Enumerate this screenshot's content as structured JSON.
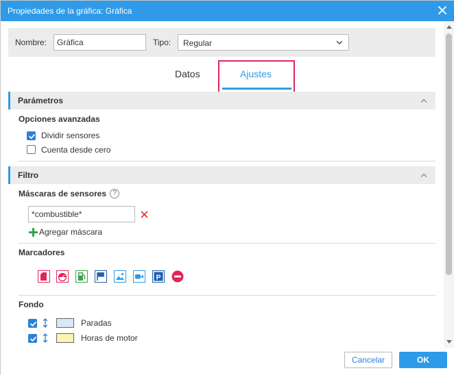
{
  "window": {
    "title": "Propiedades de la gráfica: Gráfica"
  },
  "header": {
    "name_label": "Nombre:",
    "name_value": "Gráfica",
    "type_label": "Tipo:",
    "type_value": "Regular"
  },
  "tabs": [
    {
      "label": "Datos",
      "active": false
    },
    {
      "label": "Ajustes",
      "active": true
    }
  ],
  "parametros": {
    "title": "Parámetros",
    "subtitle": "Opciones avanzadas",
    "options": [
      {
        "label": "Dividir sensores",
        "checked": true
      },
      {
        "label": "Cuenta desde cero",
        "checked": false
      }
    ]
  },
  "filtro": {
    "title": "Filtro",
    "masks_label": "Máscaras de sensores",
    "mask_value": "*combustible*",
    "add_mask_label": "Agregar máscara",
    "markers_label": "Marcadores",
    "markers": [
      {
        "icon": "fuel-fill-icon",
        "color": "#e2245c"
      },
      {
        "icon": "speedometer-icon",
        "color": "#e2245c"
      },
      {
        "icon": "fuel-station-icon",
        "color": "#3aa34a"
      },
      {
        "icon": "flag-icon",
        "color": "#1f5fae"
      },
      {
        "icon": "image-icon",
        "color": "#2f9be8"
      },
      {
        "icon": "video-icon",
        "color": "#2f9be8"
      },
      {
        "icon": "parking-icon",
        "color": "#1f5fae"
      },
      {
        "icon": "stop-icon",
        "color": "#e2245c"
      }
    ],
    "fondo_label": "Fondo",
    "fondo_items": [
      {
        "label": "Paradas",
        "checked": true,
        "color": "#d9e8f8"
      },
      {
        "label": "Horas de motor",
        "checked": true,
        "color": "#fdf3b4"
      }
    ]
  },
  "footer": {
    "cancel_label": "Cancelar",
    "ok_label": "OK"
  }
}
